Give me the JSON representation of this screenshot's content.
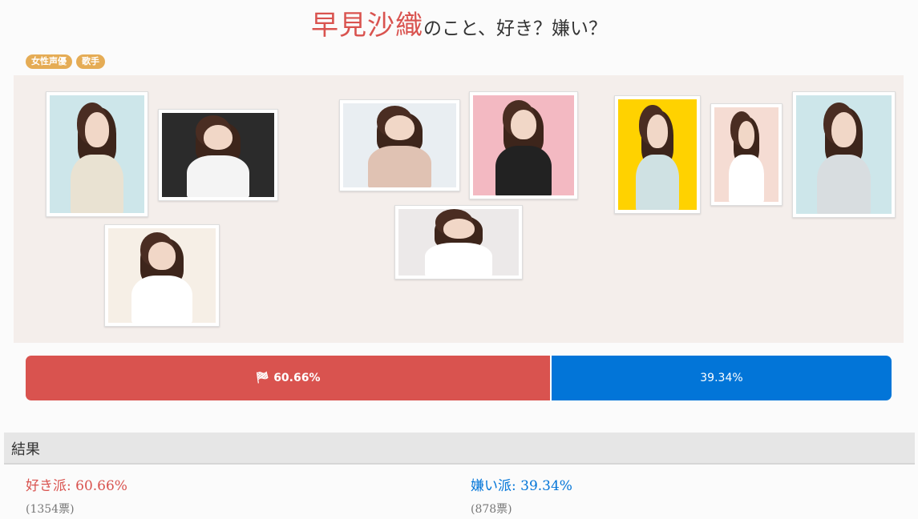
{
  "title": {
    "name": "早見沙織",
    "suffix": "のこと、好き？嫌い？"
  },
  "tags": [
    "女性声優",
    "歌手"
  ],
  "photos": [
    {
      "name": "photo-1",
      "bg": "#cde6ea",
      "outfit": "#e9e2d2"
    },
    {
      "name": "photo-2",
      "bg": "#2b2b2b",
      "outfit": "#f4f4f4"
    },
    {
      "name": "photo-3",
      "bg": "#f6efe6",
      "outfit": "#ffffff"
    },
    {
      "name": "photo-4",
      "bg": "#e9eef2",
      "outfit": "#e0c2b3"
    },
    {
      "name": "photo-5",
      "bg": "#f3b9c2",
      "outfit": "#222222"
    },
    {
      "name": "photo-6",
      "bg": "#ece9e9",
      "outfit": "#ffffff"
    },
    {
      "name": "photo-7",
      "bg": "#ffd200",
      "outfit": "#cfe1e3"
    },
    {
      "name": "photo-8",
      "bg": "#f5dcd3",
      "outfit": "#ffffff"
    },
    {
      "name": "photo-9",
      "bg": "#cde6ea",
      "outfit": "#d8dde0"
    }
  ],
  "vote_bar": {
    "like_label": "60.66%",
    "like_fraction": 0.6066,
    "dislike_label": "39.34%",
    "like_color": "#d9534f",
    "dislike_color": "#0275d8"
  },
  "results": {
    "heading": "結果",
    "like": {
      "label": "好き派: 60.66%",
      "votes": "(1354票)"
    },
    "dislike": {
      "label": "嫌い派: 39.34%",
      "votes": "(878票)"
    }
  }
}
